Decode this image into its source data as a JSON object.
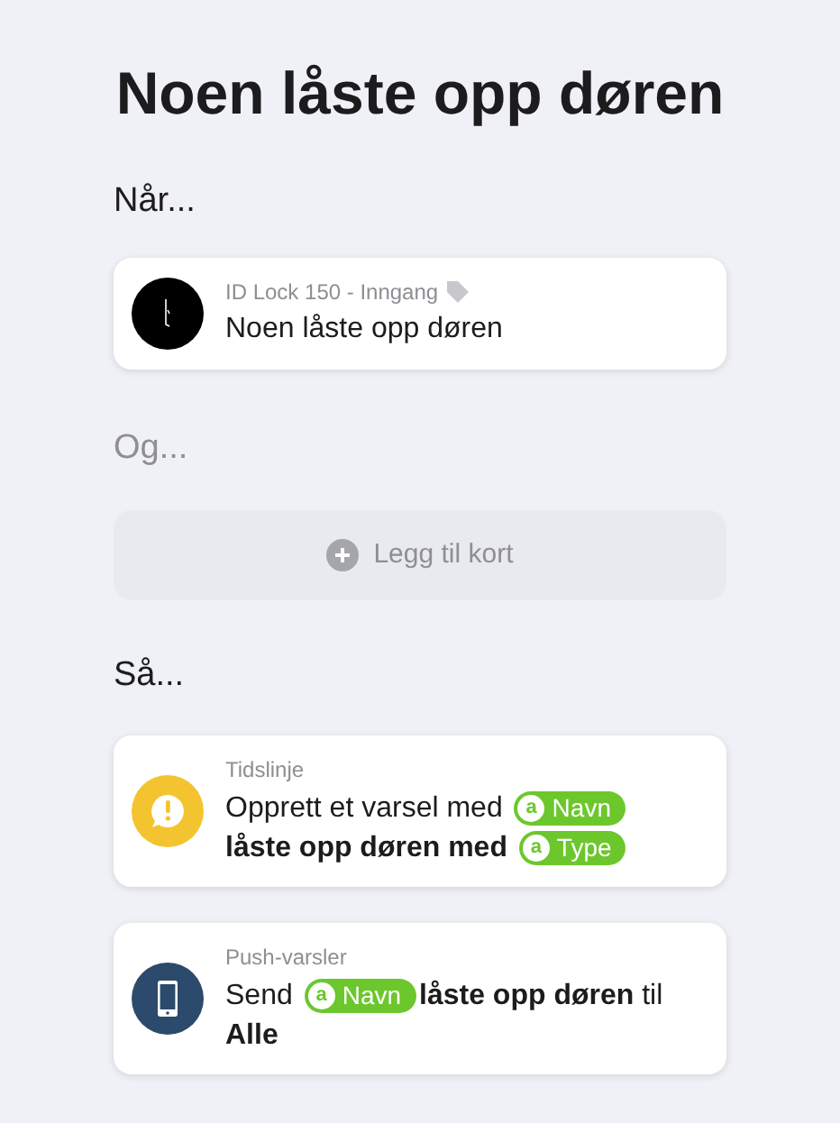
{
  "title": "Noen låste opp døren",
  "when": {
    "heading": "Når...",
    "card": {
      "kind": "lock",
      "color": "#000000",
      "subtitle": "ID Lock 150 - Inngang",
      "text": "Noen låste opp døren"
    }
  },
  "and": {
    "heading": "Og...",
    "add_button": "Legg til kort"
  },
  "then": {
    "heading": "Så...",
    "cards": [
      {
        "kind": "alert",
        "color": "#f4c430",
        "subtitle": "Tidslinje",
        "parts": [
          {
            "kind": "text",
            "text": "Opprett et varsel med",
            "bold": false
          },
          {
            "kind": "token",
            "letter": "a",
            "text": "Navn"
          },
          {
            "kind": "text",
            "text": "låste opp døren med",
            "bold": true
          },
          {
            "kind": "token",
            "letter": "a",
            "text": "Type"
          }
        ]
      },
      {
        "kind": "phone",
        "color": "#2c4a6b",
        "subtitle": "Push-varsler",
        "parts": [
          {
            "kind": "text",
            "text": "Send",
            "bold": false
          },
          {
            "kind": "token",
            "letter": "a",
            "text": "Navn"
          },
          {
            "kind": "text",
            "text": "låste opp døren",
            "bold": true
          },
          {
            "kind": "text",
            "text": "til",
            "bold": false
          },
          {
            "kind": "text",
            "text": "Alle",
            "bold": true
          }
        ]
      }
    ]
  }
}
